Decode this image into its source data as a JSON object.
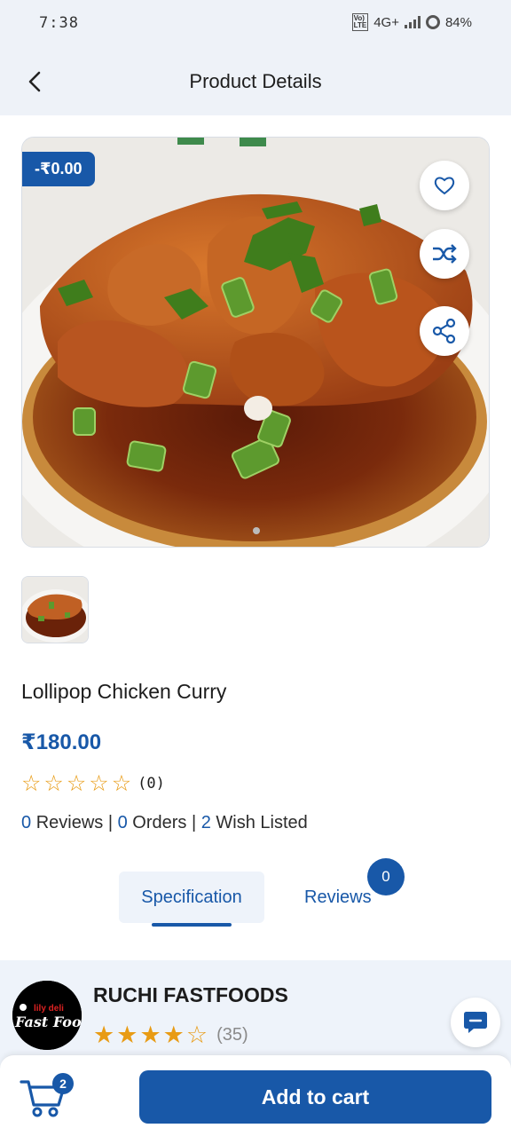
{
  "status_bar": {
    "time": "7:38",
    "network": "4G+",
    "volte_top": "Vo)",
    "volte_bottom": "LTE",
    "battery": "84%"
  },
  "header": {
    "title": "Product Details",
    "back_icon": "chevron-left-icon"
  },
  "product": {
    "discount": "-₹0.00",
    "name": "Lollipop Chicken Curry",
    "price": "₹180.00",
    "rating_value": 0,
    "rating_max": 5,
    "rating_count": "(0)",
    "reviews_count": "0",
    "reviews_label": "Reviews",
    "orders_count": "0",
    "orders_label": "Orders",
    "wishlist_count": "2",
    "wishlist_label": "Wish Listed",
    "separator": "|",
    "image_index": 1,
    "image_total": 1
  },
  "actions": {
    "wishlist_icon": "heart-icon",
    "compare_icon": "shuffle-icon",
    "share_icon": "share-icon"
  },
  "tabs": {
    "specification": "Specification",
    "reviews": "Reviews",
    "reviews_badge": "0"
  },
  "shop": {
    "name": "RUCHI FASTFOODS",
    "logo_text_top": "lily deli",
    "logo_text_bottom": "Fast Foods",
    "rating_value": 4.5,
    "rating_max": 5,
    "rating_count": "(35)",
    "chat_icon": "chat-icon"
  },
  "bottom_bar": {
    "cart_badge": "2",
    "add_to_cart_label": "Add to cart",
    "cart_icon": "cart-icon"
  },
  "colors": {
    "brand": "#1858a8",
    "star": "#e89b14",
    "header_bg": "#eef2f8"
  }
}
